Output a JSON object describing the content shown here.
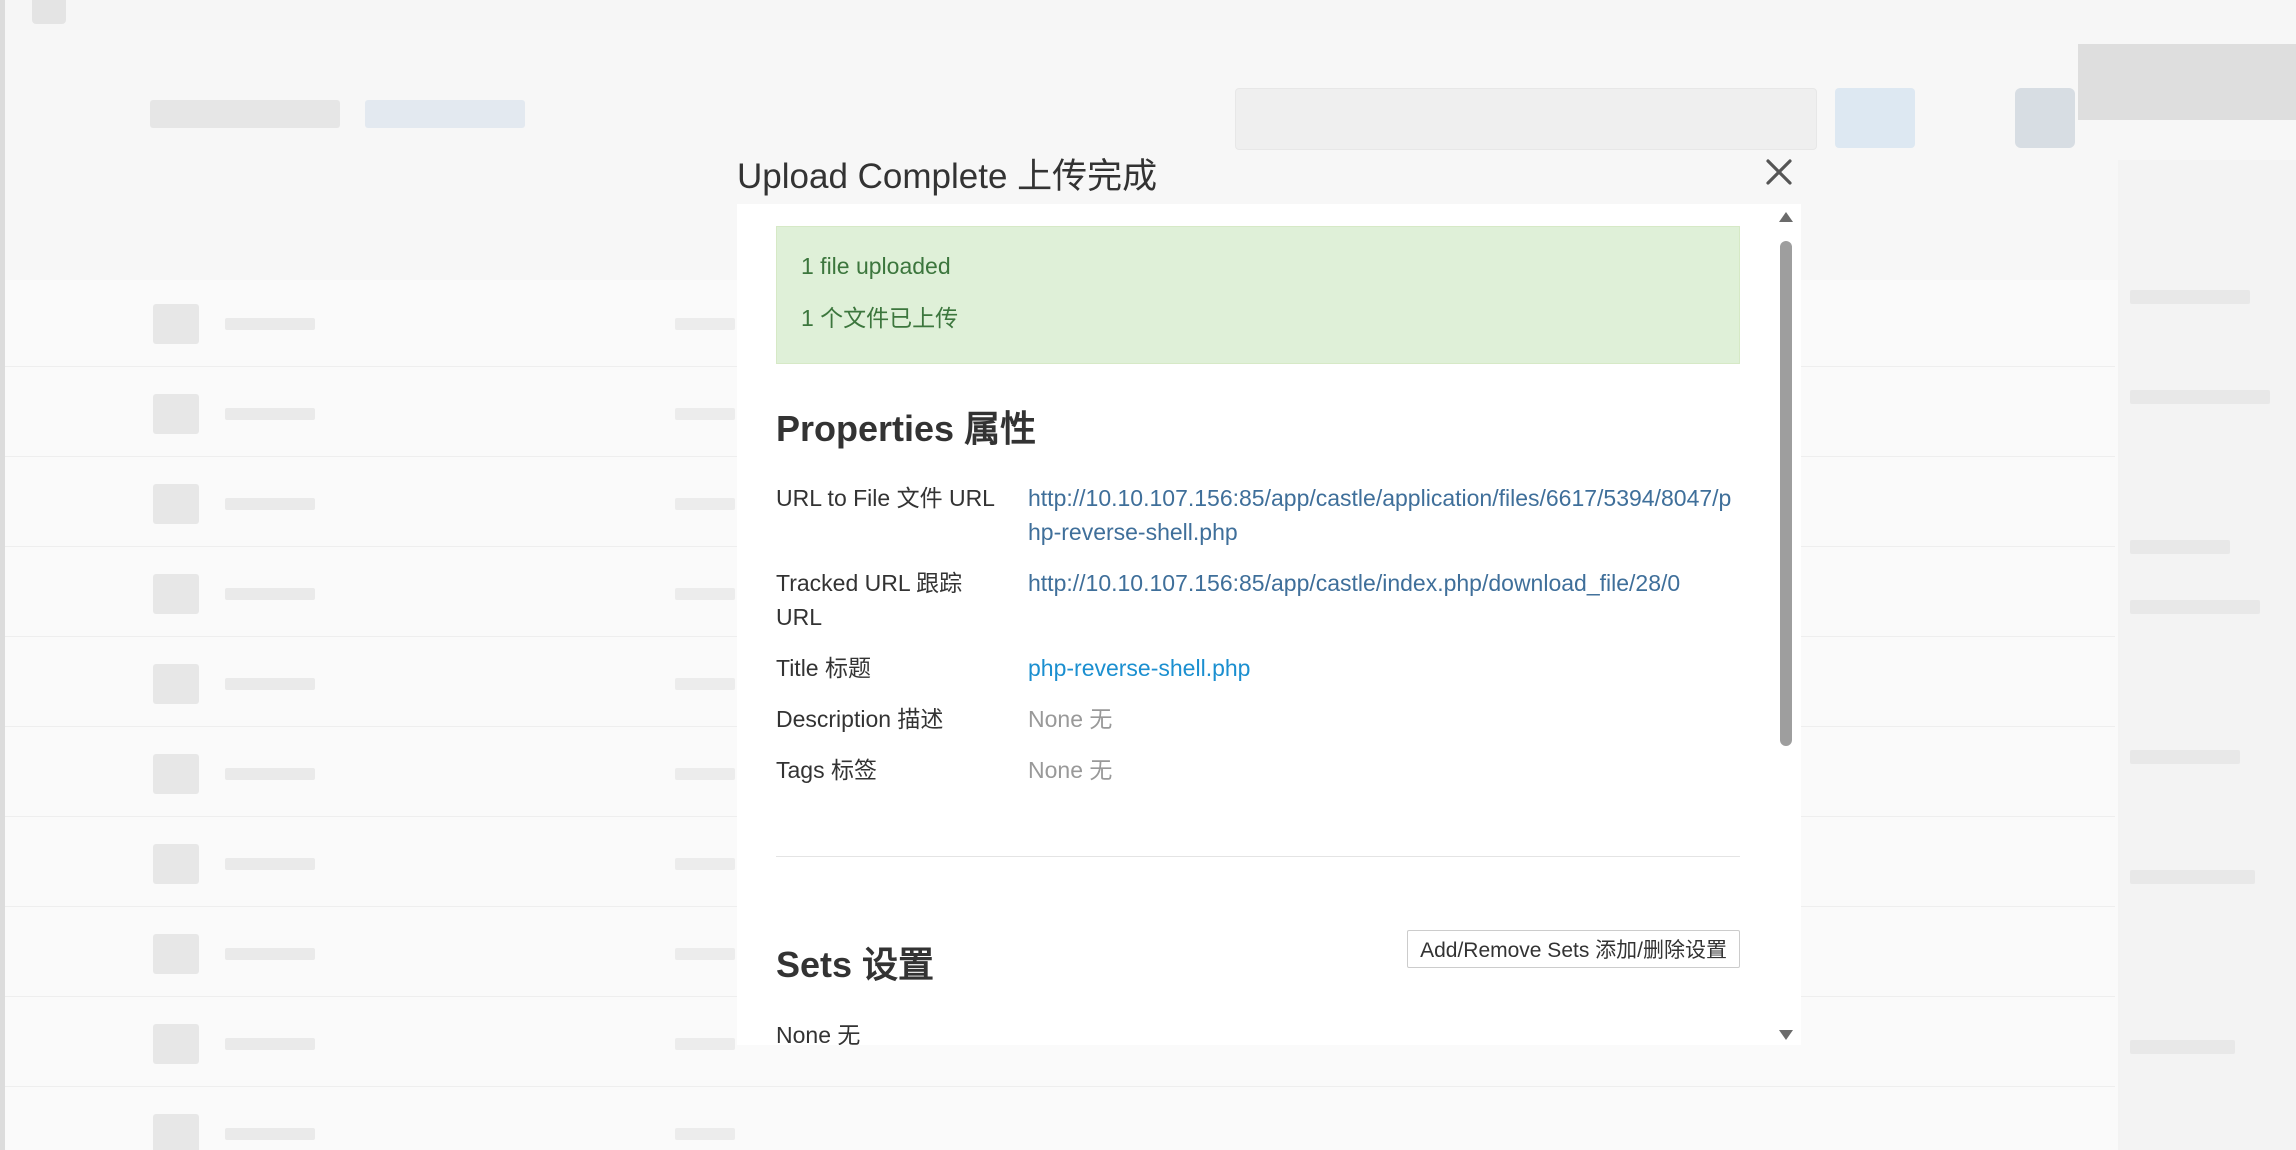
{
  "modal": {
    "title": "Upload Complete  上传完成",
    "close_icon": "close-icon"
  },
  "alert": {
    "line1": "1 file uploaded",
    "line2": "1 个文件已上传"
  },
  "properties": {
    "heading": "Properties  属性",
    "rows": [
      {
        "label": "URL to File  文件 URL",
        "value": "http://10.10.107.156:85/app/castle/application/files/6617/5394/8047/php-reverse-shell.php"
      },
      {
        "label": "Tracked URL  跟踪 URL",
        "value": "http://10.10.107.156:85/app/castle/index.php/download_file/28/0"
      },
      {
        "label": "Title  标题",
        "value": "php-reverse-shell.php"
      },
      {
        "label": "Description  描述",
        "value": "None  无"
      },
      {
        "label": "Tags  标签",
        "value": "None  无"
      }
    ]
  },
  "sets": {
    "heading": "Sets   设置",
    "button_label": "Add/Remove Sets  添加/删除设置",
    "none_text": "None  无"
  },
  "colors": {
    "success_bg": "#dff0d8",
    "success_text": "#3c763d",
    "link": "#3f6f9a",
    "link_strong": "#1b8fd0",
    "muted": "#999999"
  }
}
